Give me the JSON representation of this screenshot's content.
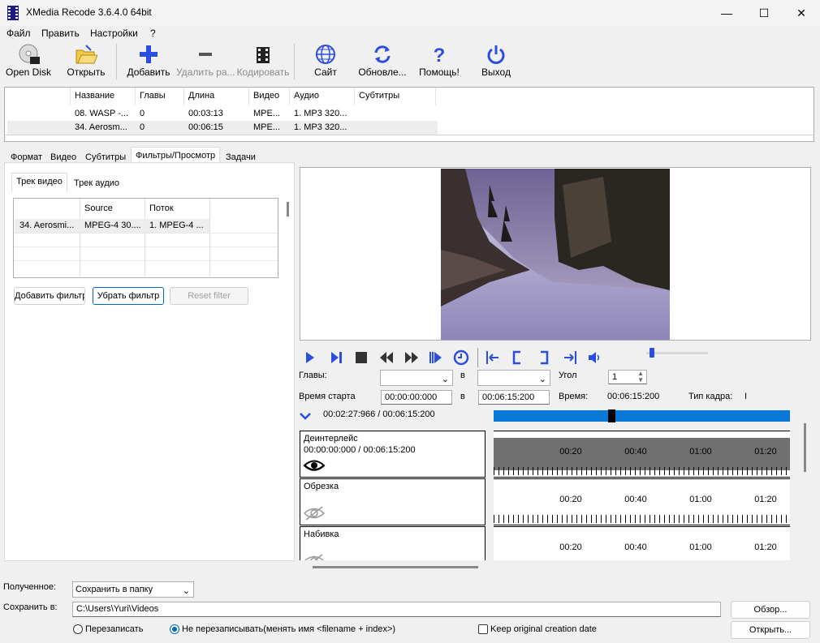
{
  "window": {
    "title": "XMedia Recode 3.6.4.0 64bit",
    "minimize": "—",
    "maximize": "☐",
    "close": "✕"
  },
  "menu": [
    "Файл",
    "Править",
    "Настройки",
    "?"
  ],
  "toolbar": {
    "open_disk": "Open Disk",
    "open": "Открыть",
    "add": "Добавить",
    "remove": "Удалить ра...",
    "encode": "Кодировать",
    "site": "Сайт",
    "update": "Обновле...",
    "help": "Помощь!",
    "exit": "Выход"
  },
  "filelist": {
    "columns": [
      "Название",
      "Главы",
      "Длина",
      "Видео",
      "Аудио",
      "Субтитры"
    ],
    "rows": [
      [
        "08. WASP -...",
        "0",
        "00:03:13",
        "MPE...",
        "1. MP3 320...",
        ""
      ],
      [
        "34. Aerosm...",
        "0",
        "00:06:15",
        "MPE...",
        "1. MP3 320...",
        ""
      ]
    ]
  },
  "tabs": [
    "Формат",
    "Видео",
    "Субтитры",
    "Фильтры/Просмотр",
    "Задачи"
  ],
  "subtabs": [
    "Трек видео",
    "Трек аудио"
  ],
  "filtertable": {
    "columns": [
      "",
      "Source",
      "Поток"
    ],
    "row": [
      "34. Aerosmi...",
      "MPEG-4 30....",
      "1. MPEG-4 ..."
    ]
  },
  "filter_buttons": {
    "add": "Добавить фильтр",
    "remove": "Убрать фильтр",
    "reset": "Reset filter"
  },
  "controls": {
    "chapters_label": "Главы:",
    "in_label": "в",
    "angle_label": "Угол",
    "angle_value": "1",
    "start_label": "Время старта",
    "start_value": "00:00:00:000",
    "end_value": "00:06:15:200",
    "time_label": "Время:",
    "time_value": "00:06:15:200",
    "frametype_label": "Тип кадра:",
    "frametype_value": "I",
    "position": "00:02:27:966 / 00:06:15:200",
    "seek_fraction": 0.395
  },
  "tracks": [
    {
      "name": "Деинтерлейс",
      "range": "00:00:00:000 / 00:06:15:200",
      "eye": "eye-open-icon"
    },
    {
      "name": "Обрезка",
      "range": "",
      "eye": "eye-closed-icon"
    },
    {
      "name": "Набивка",
      "range": "",
      "eye": "eye-closed-icon"
    }
  ],
  "timeline_ticks": [
    "00:20",
    "00:40",
    "01:00",
    "01:20"
  ],
  "output": {
    "received_label": "Полученное:",
    "received_value": "Сохранить в папку",
    "save_label": "Сохранить в:",
    "save_path": "C:\\Users\\Yuri\\Videos",
    "browse": "Обзор...",
    "open": "Открыть...",
    "overwrite": "Перезаписать",
    "no_overwrite": "Не перезаписывать(менять имя <filename + index>)",
    "keep_date": "Keep original creation date"
  },
  "colors": {
    "accent": "#2b4fdc",
    "seekbar": "#0a78d7"
  }
}
